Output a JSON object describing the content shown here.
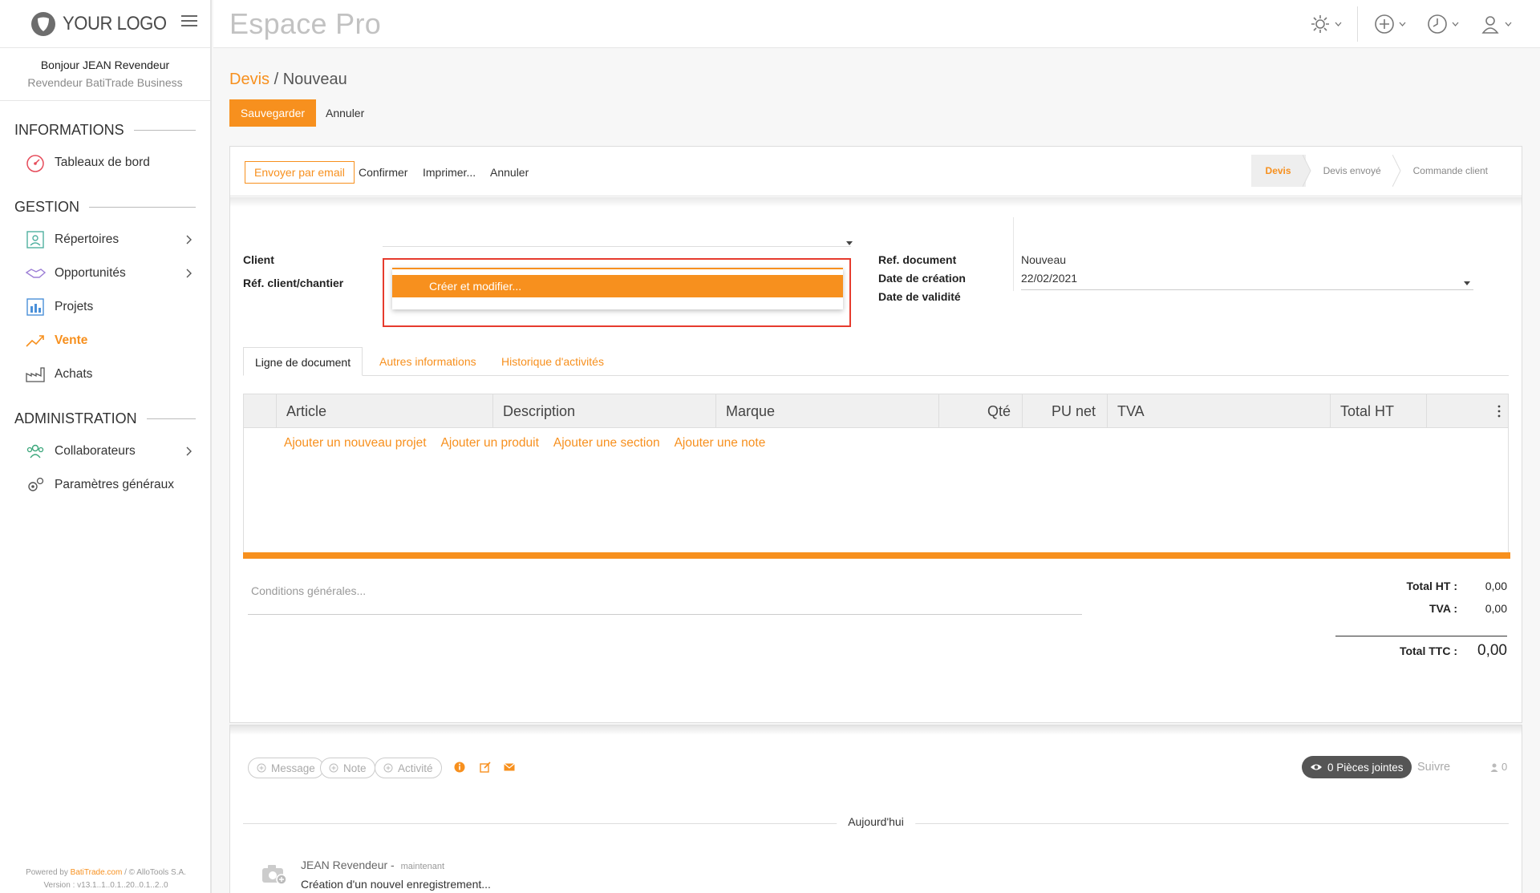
{
  "sidebar": {
    "logo_text": "YOUR LOGO",
    "greeting": "Bonjour JEAN Revendeur",
    "role": "Revendeur BatiTrade Business",
    "sections": {
      "informations": "INFORMATIONS",
      "gestion": "GESTION",
      "administration": "ADMINISTRATION"
    },
    "items": {
      "dashboard": "Tableaux de bord",
      "directories": "Répertoires",
      "opportunities": "Opportunités",
      "projects": "Projets",
      "sales": "Vente",
      "purchases": "Achats",
      "collaborators": "Collaborateurs",
      "settings": "Paramètres généraux"
    },
    "footer": {
      "powered_prefix": "Powered by ",
      "powered_brand": "BatiTrade.com",
      "powered_suffix": " / © AlloTools S.A.",
      "version": "Version : v13.1..1..0.1..20..0.1..2..0"
    }
  },
  "header": {
    "app_title": "Espace Pro"
  },
  "page": {
    "breadcrumb_parent": "Devis",
    "breadcrumb_sep": " / ",
    "breadcrumb_current": "Nouveau",
    "save_label": "Sauvegarder",
    "discard_label": "Annuler"
  },
  "statusbar": {
    "email_label": "Envoyer par email",
    "confirm_label": "Confirmer",
    "print_label": "Imprimer...",
    "cancel_label": "Annuler",
    "stages": [
      "Devis",
      "Devis envoyé",
      "Commande client"
    ]
  },
  "form": {
    "client_label": "Client",
    "ref_label": "Réf. client/chantier",
    "dropdown_option": "Créer et modifier...",
    "ref_doc_label": "Ref. document",
    "ref_doc_value": "Nouveau",
    "creation_date_label": "Date de création",
    "creation_date_value": "22/02/2021",
    "validity_date_label": "Date de validité"
  },
  "tabs": [
    "Ligne de document",
    "Autres informations",
    "Historique d'activités"
  ],
  "lines_table": {
    "columns": [
      "Article",
      "Description",
      "Marque",
      "Qté",
      "PU net",
      "TVA",
      "Total HT"
    ],
    "add_links": [
      "Ajouter un nouveau projet",
      "Ajouter un produit",
      "Ajouter une section",
      "Ajouter une note"
    ]
  },
  "conditions_placeholder": "Conditions générales...",
  "totals": {
    "ht_label": "Total HT :",
    "ht_value": "0,00",
    "tva_label": "TVA :",
    "tva_value": "0,00",
    "ttc_label": "Total TTC :",
    "ttc_value": "0,00"
  },
  "chatter": {
    "message_label": "Message",
    "note_label": "Note",
    "activity_label": "Activité",
    "attachments_label": "0 Pièces jointes",
    "follow_label": "Suivre",
    "followers_count": "0",
    "today_label": "Aujourd'hui",
    "author": "JEAN Revendeur",
    "author_sep": " - ",
    "time": "maintenant",
    "message_text": "Création d'un nouvel enregistrement..."
  },
  "colors": {
    "accent": "#f7901e",
    "highlight_border": "#e63b2e"
  },
  "icons": [
    "logo-shield-icon",
    "hamburger-icon",
    "gear-icon",
    "plus-circle-icon",
    "clock-icon",
    "user-icon",
    "dashboard-gauge-icon",
    "directory-icon",
    "handshake-icon",
    "projects-icon",
    "chart-line-icon",
    "factory-icon",
    "team-icon",
    "settings-gears-icon",
    "chevron-right-icon",
    "caret-down-icon",
    "kebab-menu-icon",
    "info-icon",
    "edit-icon",
    "envelope-icon",
    "eye-icon",
    "camera-avatar-icon"
  ]
}
